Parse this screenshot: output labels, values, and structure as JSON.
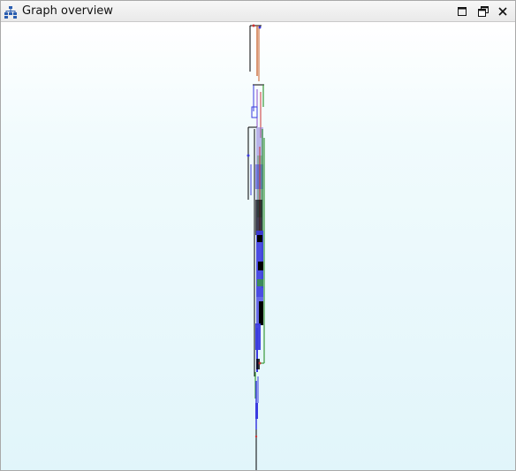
{
  "window": {
    "title": "Graph overview",
    "title_icon": "graph-hierarchy-icon",
    "buttons": {
      "maximize_icon": "maximize-icon",
      "restore_icon": "restore-icon",
      "close_icon": "close-icon"
    }
  },
  "canvas": {
    "view": "graph-overview",
    "colors": {
      "background_top": "#ffffff",
      "background_bottom": "#e1f5fa",
      "node": "#3a3ae0",
      "edge_black": "#000000",
      "edge_green": "#3a9a3a",
      "edge_red": "#cc3333",
      "edge_orange": "#c8602a",
      "edge_purple": "#8a4ac8"
    }
  }
}
